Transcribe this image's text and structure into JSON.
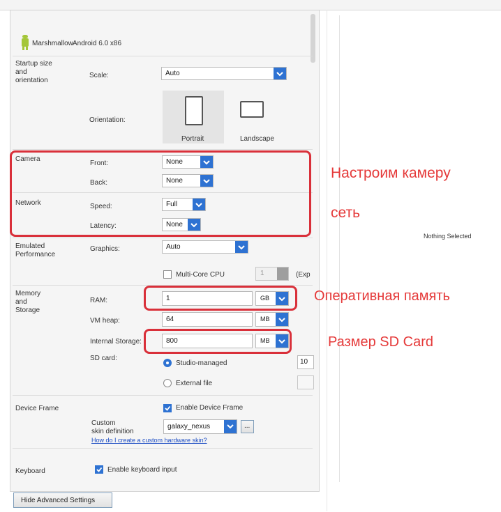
{
  "system_image": {
    "name": "Marshmallow",
    "api": "Android 6.0 x86"
  },
  "startup": {
    "section": "Startup size\nand\norientation",
    "scale_label": "Scale:",
    "scale_value": "Auto",
    "orientation_label": "Orientation:",
    "portrait_label": "Portrait",
    "landscape_label": "Landscape"
  },
  "camera": {
    "section": "Camera",
    "front_label": "Front:",
    "front_value": "None",
    "back_label": "Back:",
    "back_value": "None"
  },
  "network": {
    "section": "Network",
    "speed_label": "Speed:",
    "speed_value": "Full",
    "latency_label": "Latency:",
    "latency_value": "None"
  },
  "performance": {
    "section": "Emulated\nPerformance",
    "graphics_label": "Graphics:",
    "graphics_value": "Auto",
    "multicore_label": "Multi-Core CPU",
    "multicore_value": "1",
    "multicore_hint": "(Exp"
  },
  "memory": {
    "section": "Memory\nand\nStorage",
    "ram_label": "RAM:",
    "ram_value": "1",
    "ram_unit": "GB",
    "vmheap_label": "VM heap:",
    "vmheap_value": "64",
    "vmheap_unit": "MB",
    "internal_label": "Internal Storage:",
    "internal_value": "800",
    "internal_unit": "MB",
    "sdcard_label": "SD card:",
    "studio_managed_label": "Studio-managed",
    "studio_value": "10",
    "external_file_label": "External file"
  },
  "device_frame": {
    "section": "Device Frame",
    "enable_label": "Enable Device Frame",
    "custom_label": "Custom\nskin definition",
    "skin_value": "galaxy_nexus",
    "browse_label": "...",
    "help_link": "How do I create a custom hardware skin?"
  },
  "keyboard": {
    "section": "Keyboard",
    "enable_label": "Enable keyboard input"
  },
  "hide_button": "Hide Advanced Settings",
  "right_panel": {
    "nothing_selected": "Nothing Selected"
  },
  "annotations": {
    "camera": "Настроим камеру",
    "network": "сеть",
    "ram": "Оперативная память",
    "sdcard": "Размер SD Card"
  },
  "colors": {
    "accent": "#2e72d2",
    "annotation": "#e53a3a"
  }
}
